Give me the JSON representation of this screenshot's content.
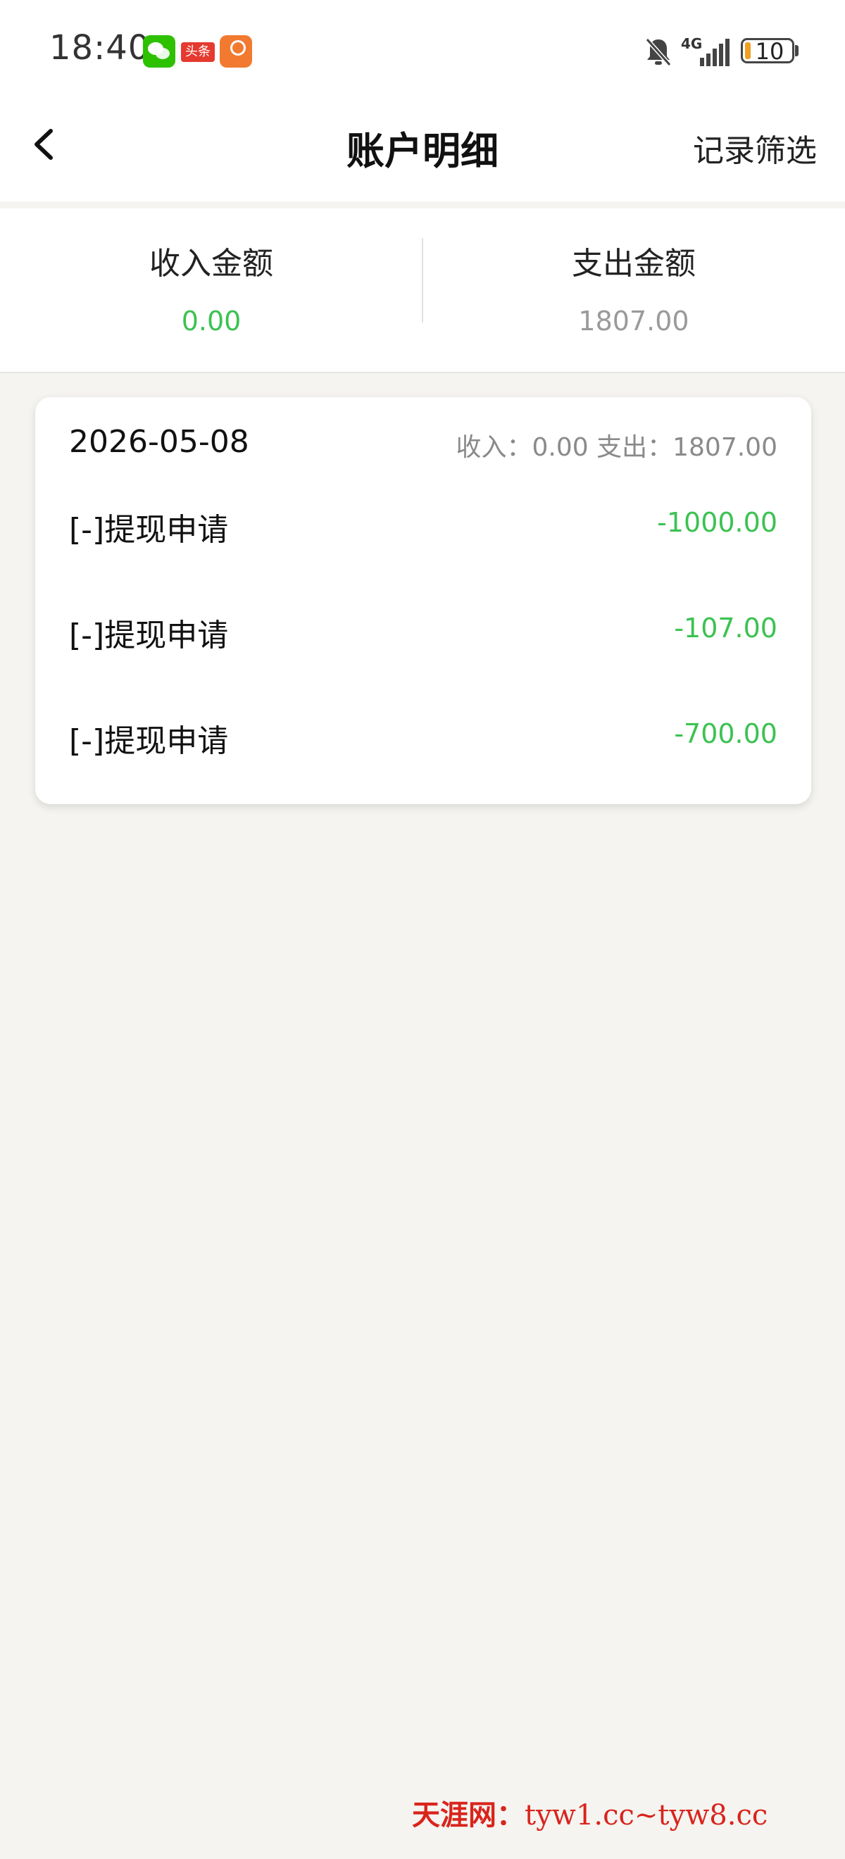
{
  "status_bar": {
    "time": "18:40",
    "apps": [
      "wechat-icon",
      "toutiao-icon",
      "app-icon"
    ],
    "toutiao_label": "头条",
    "network": "4G",
    "battery_level": "10"
  },
  "header": {
    "title": "账户明细",
    "filter_label": "记录筛选"
  },
  "summary": {
    "income_label": "收入金额",
    "income_value": "0.00",
    "expense_label": "支出金额",
    "expense_value": "1807.00"
  },
  "record_group": {
    "date": "2026-05-08",
    "summary_text": "收入：0.00 支出：1807.00",
    "records": [
      {
        "title": "[-]提现申请",
        "amount": "-1000.00"
      },
      {
        "title": "[-]提现申请",
        "amount": "-107.00"
      },
      {
        "title": "[-]提现申请",
        "amount": "-700.00"
      }
    ]
  },
  "watermark": {
    "brand": "天涯网：",
    "url": "tyw1.cc~tyw8.cc"
  },
  "colors": {
    "accent_green": "#3cc252",
    "muted_gray": "#9a9a9a",
    "background": "#f5f4f0",
    "watermark_red": "#d9241c"
  }
}
